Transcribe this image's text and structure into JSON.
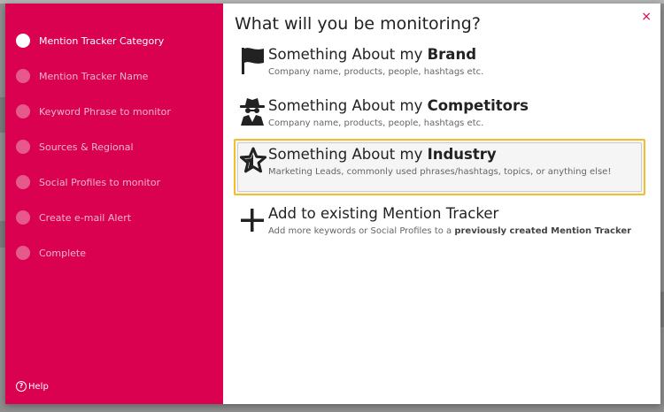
{
  "sidebar": {
    "steps": [
      {
        "label": "Mention Tracker Category",
        "active": true
      },
      {
        "label": "Mention Tracker Name",
        "active": false
      },
      {
        "label": "Keyword Phrase to monitor",
        "active": false
      },
      {
        "label": "Sources & Regional",
        "active": false
      },
      {
        "label": "Social Profiles to monitor",
        "active": false
      },
      {
        "label": "Create e-mail Alert",
        "active": false
      },
      {
        "label": "Complete",
        "active": false
      }
    ],
    "help_label": "Help",
    "help_icon_glyph": "?"
  },
  "content": {
    "close_glyph": "×",
    "heading": "What will you be monitoring?",
    "options": [
      {
        "icon": "flag-icon",
        "title_prefix": "Something About my ",
        "title_bold": "Brand",
        "desc": "Company name, products, people, hashtags etc.",
        "desc_bold": "",
        "desc_suffix": "",
        "selected": false
      },
      {
        "icon": "spy-icon",
        "title_prefix": "Something About my ",
        "title_bold": "Competitors",
        "desc": "Company name, products, people, hashtags etc.",
        "desc_bold": "",
        "desc_suffix": "",
        "selected": false
      },
      {
        "icon": "star-icon",
        "title_prefix": "Something About my ",
        "title_bold": "Industry",
        "desc": "Marketing Leads, commonly used phrases/hashtags, topics, or anything else!",
        "desc_bold": "",
        "desc_suffix": "",
        "selected": true
      },
      {
        "icon": "plus-icon",
        "title_prefix": "Add to existing Mention Tracker",
        "title_bold": "",
        "desc": "Add more keywords or Social Profiles to a ",
        "desc_bold": "previously created Mention Tracker",
        "desc_suffix": "",
        "selected": false
      }
    ]
  },
  "colors": {
    "sidebar_bg": "#da0150",
    "selected_border": "#f5bd2c"
  }
}
